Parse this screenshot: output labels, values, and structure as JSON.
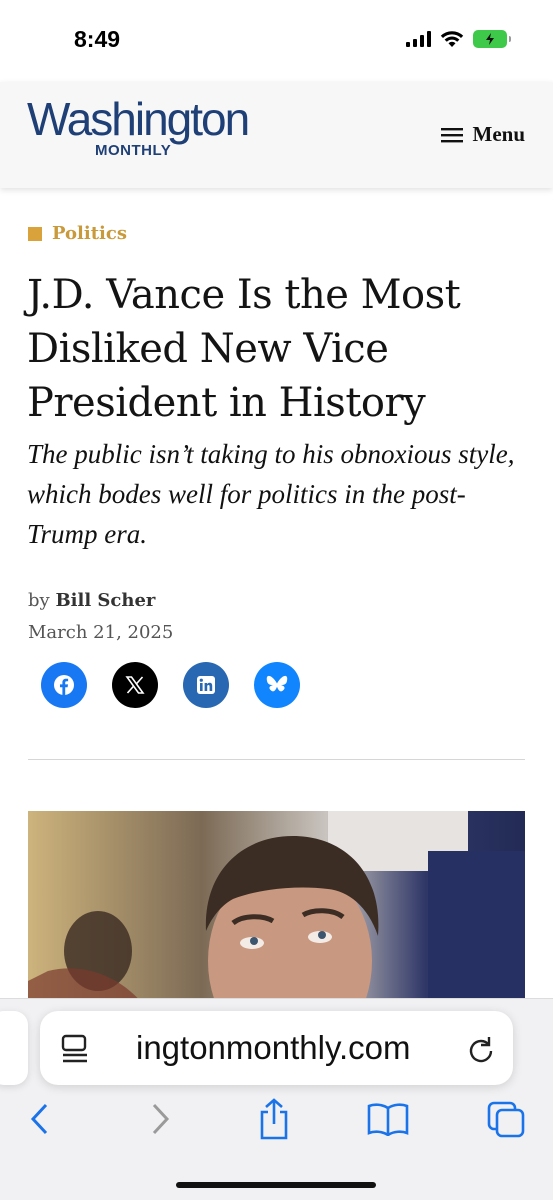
{
  "status_bar": {
    "time": "8:49"
  },
  "site": {
    "logo_main": "Washington",
    "logo_sub": "MONTHLY",
    "menu_label": "Menu"
  },
  "article": {
    "category": "Politics",
    "headline": "J.D. Vance Is the Most Disliked New Vice President in History",
    "dek": "The public isn’t taking to his obnoxious style, which bodes well for politics in the post-Trump era.",
    "byline_prefix": "by",
    "author": "Bill Scher",
    "date": "March 21, 2025",
    "share_buttons": [
      {
        "name": "facebook",
        "icon": "facebook-icon",
        "color": "#1877f2"
      },
      {
        "name": "x",
        "icon": "x-icon",
        "color": "#000000"
      },
      {
        "name": "linkedin",
        "icon": "linkedin-icon",
        "color": "#2867b2"
      },
      {
        "name": "bluesky",
        "icon": "bluesky-icon",
        "color": "#1185fe"
      }
    ]
  },
  "browser": {
    "url": "ingtonmonthly.com",
    "icons": [
      "back-icon",
      "forward-icon",
      "share-icon",
      "bookmarks-icon",
      "tabs-icon",
      "reader-icon",
      "reload-icon"
    ]
  },
  "colors": {
    "brand_navy": "#1f3f77",
    "category_gold": "#c99a3b",
    "battery_green": "#3fc94a"
  }
}
